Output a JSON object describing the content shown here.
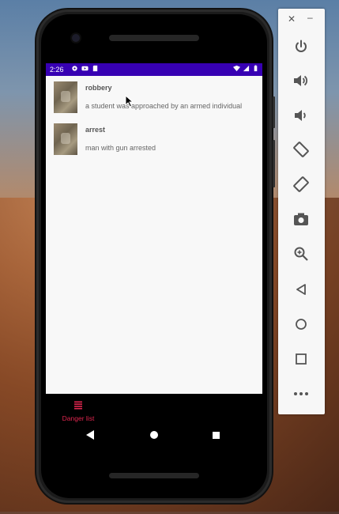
{
  "status_bar": {
    "time": "2:26",
    "background_color": "#3700b3",
    "left_icons": [
      "settings-icon",
      "youtube-icon",
      "sd-card-icon"
    ],
    "right_icons": [
      "wifi-icon",
      "signal-icon",
      "battery-icon"
    ]
  },
  "list": {
    "items": [
      {
        "title": "robbery",
        "description": "a student was approached by an armed individual"
      },
      {
        "title": "arrest",
        "description": "man with gun arrested"
      }
    ]
  },
  "bottom_nav": {
    "tabs": [
      {
        "label": "Danger list",
        "icon": "list-icon",
        "color": "#e0264f"
      }
    ]
  },
  "system_nav": {
    "buttons": [
      "back-icon",
      "home-icon",
      "recents-icon"
    ]
  },
  "emulator_toolbar": {
    "window_controls": [
      "close-icon",
      "minimize-icon"
    ],
    "buttons": [
      "power-icon",
      "volume-up-icon",
      "volume-down-icon",
      "rotate-left-icon",
      "rotate-right-icon",
      "camera-icon",
      "zoom-icon",
      "back-icon",
      "home-icon",
      "overview-icon",
      "more-icon"
    ]
  }
}
